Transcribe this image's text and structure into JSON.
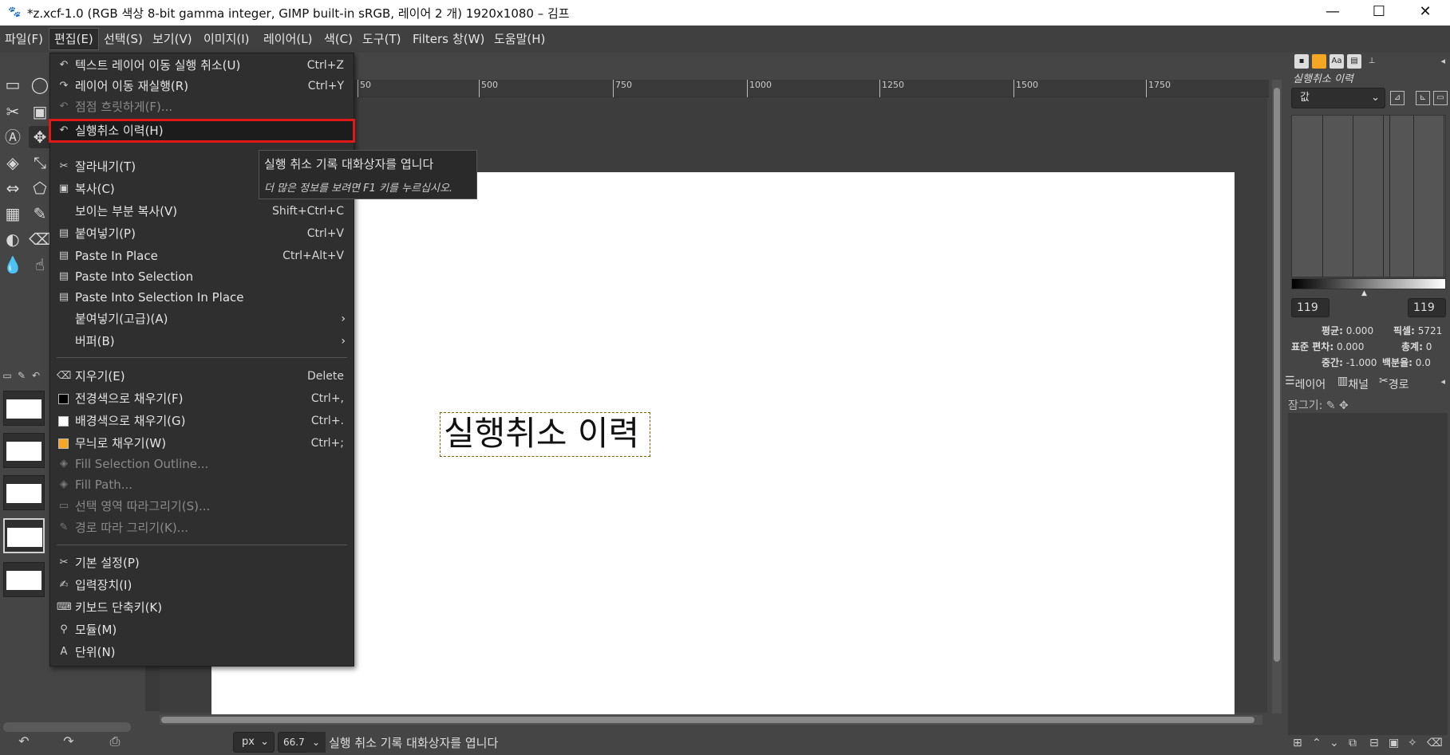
{
  "window": {
    "title": "*z.xcf-1.0 (RGB 색상 8-bit gamma integer, GIMP built-in sRGB, 레이어 2 개) 1920x1080 – 김프",
    "minimize": "—",
    "maximize": "☐",
    "close": "✕"
  },
  "menubar": [
    {
      "label": "파일(F)"
    },
    {
      "label": "편집(E)"
    },
    {
      "label": "선택(S)"
    },
    {
      "label": "보기(V)"
    },
    {
      "label": "이미지(I)"
    },
    {
      "label": "레이어(L)"
    },
    {
      "label": "색(C)"
    },
    {
      "label": "도구(T)"
    },
    {
      "label": "Filters"
    },
    {
      "label": "창(W)"
    },
    {
      "label": "도움말(H)"
    }
  ],
  "edit_menu": {
    "items": [
      {
        "label": "텍스트 레이어 이동 실행 취소(U)",
        "shortcut": "Ctrl+Z",
        "icon": "undo-icon",
        "enabled": true
      },
      {
        "label": "레이어 이동 재실행(R)",
        "shortcut": "Ctrl+Y",
        "icon": "redo-icon",
        "enabled": true
      },
      {
        "label": "점점 흐릿하게(F)...",
        "shortcut": "",
        "icon": "fade-icon",
        "enabled": false
      },
      {
        "label": "실행취소 이력(H)",
        "shortcut": "",
        "icon": "undo-history-icon",
        "enabled": true,
        "highlighted": true
      },
      {
        "label": "잘라내기(T)",
        "shortcut": "",
        "icon": "cut-icon",
        "enabled": true
      },
      {
        "label": "복사(C)",
        "shortcut": "",
        "icon": "copy-icon",
        "enabled": true
      },
      {
        "label": "보이는 부분 복사(V)",
        "shortcut": "Shift+Ctrl+C",
        "icon": "",
        "enabled": true
      },
      {
        "label": "붙여넣기(P)",
        "shortcut": "Ctrl+V",
        "icon": "paste-icon",
        "enabled": true
      },
      {
        "label": "Paste In Place",
        "shortcut": "Ctrl+Alt+V",
        "icon": "paste-icon",
        "enabled": true
      },
      {
        "label": "Paste Into Selection",
        "shortcut": "",
        "icon": "paste-icon",
        "enabled": true
      },
      {
        "label": "Paste Into Selection In Place",
        "shortcut": "",
        "icon": "paste-icon",
        "enabled": true
      },
      {
        "label": "붙여넣기(고급)(A)",
        "shortcut": "",
        "icon": "",
        "enabled": true,
        "submenu": true
      },
      {
        "label": "버퍼(B)",
        "shortcut": "",
        "icon": "",
        "enabled": true,
        "submenu": true
      },
      {
        "label": "지우기(E)",
        "shortcut": "Delete",
        "icon": "clear-icon",
        "enabled": true
      },
      {
        "label": "전경색으로 채우기(F)",
        "shortcut": "Ctrl+,",
        "icon": "fg-fill-icon",
        "enabled": true
      },
      {
        "label": "배경색으로 채우기(G)",
        "shortcut": "Ctrl+.",
        "icon": "bg-fill-icon",
        "enabled": true
      },
      {
        "label": "무늬로 채우기(W)",
        "shortcut": "Ctrl+;",
        "icon": "pattern-fill-icon",
        "enabled": true
      },
      {
        "label": "Fill Selection Outline...",
        "shortcut": "",
        "icon": "fill-outline-icon",
        "enabled": false
      },
      {
        "label": "Fill Path...",
        "shortcut": "",
        "icon": "fill-path-icon",
        "enabled": false
      },
      {
        "label": "선택 영역 따라그리기(S)...",
        "shortcut": "",
        "icon": "stroke-selection-icon",
        "enabled": false
      },
      {
        "label": "경로 따라 그리기(K)...",
        "shortcut": "",
        "icon": "stroke-path-icon",
        "enabled": false
      },
      {
        "label": "기본 설정(P)",
        "shortcut": "",
        "icon": "preferences-icon",
        "enabled": true
      },
      {
        "label": "입력장치(I)",
        "shortcut": "",
        "icon": "input-devices-icon",
        "enabled": true
      },
      {
        "label": "키보드 단축키(K)",
        "shortcut": "",
        "icon": "keyboard-icon",
        "enabled": true
      },
      {
        "label": "모듈(M)",
        "shortcut": "",
        "icon": "modules-icon",
        "enabled": true
      },
      {
        "label": "단위(N)",
        "shortcut": "",
        "icon": "units-icon",
        "enabled": true
      }
    ]
  },
  "tooltip": {
    "title": "실행 취소 기록 대화상자를 엽니다",
    "hint": "더 많은 정보를 보려면 F1 키를 누르십시오."
  },
  "ruler": {
    "ticks": [
      "500",
      "750",
      "1000",
      "1250",
      "1500",
      "1750"
    ],
    "partial": "50"
  },
  "canvas": {
    "text_layer": "실행취소 이력"
  },
  "statusbar": {
    "unit": "px",
    "zoom": "66.7 %",
    "message": "실행 취소 기록 대화상자를 엽니다"
  },
  "dock": {
    "title": "실행취소 이력",
    "channel": "값",
    "range_min": "119",
    "range_max": "119",
    "stats": {
      "mean_label": "평균:",
      "mean": "0.000",
      "std_label": "표준 편차:",
      "std": "0.000",
      "median_label": "중간:",
      "median": "-1.000",
      "pixels_label": "픽셀:",
      "pixels": "5721",
      "count_label": "총계:",
      "count": "0",
      "percentile_label": "백분율:",
      "percentile": "0.0"
    },
    "layers_tab": "레이어",
    "channels_tab": "채널",
    "paths_tab": "경로",
    "lock_label": "잠그기:"
  }
}
